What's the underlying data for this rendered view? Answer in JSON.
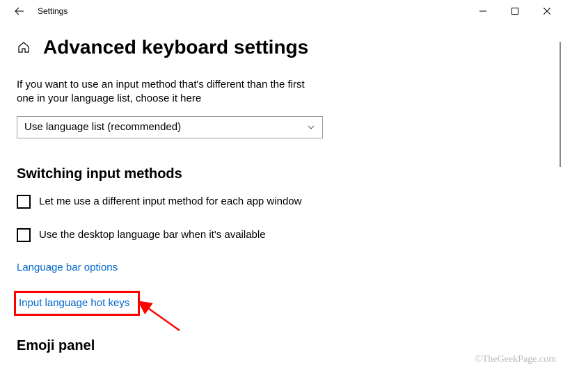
{
  "window": {
    "title": "Settings"
  },
  "page": {
    "title": "Advanced keyboard settings",
    "description": "If you want to use an input method that's different than the first one in your language list, choose it here"
  },
  "dropdown": {
    "selected": "Use language list (recommended)"
  },
  "sections": {
    "switching": {
      "heading": "Switching input methods",
      "checkbox1": "Let me use a different input method for each app window",
      "checkbox2": "Use the desktop language bar when it's available",
      "link1": "Language bar options",
      "link2": "Input language hot keys"
    },
    "emoji": {
      "heading": "Emoji panel"
    }
  },
  "watermark": "©TheGeekPage.com"
}
